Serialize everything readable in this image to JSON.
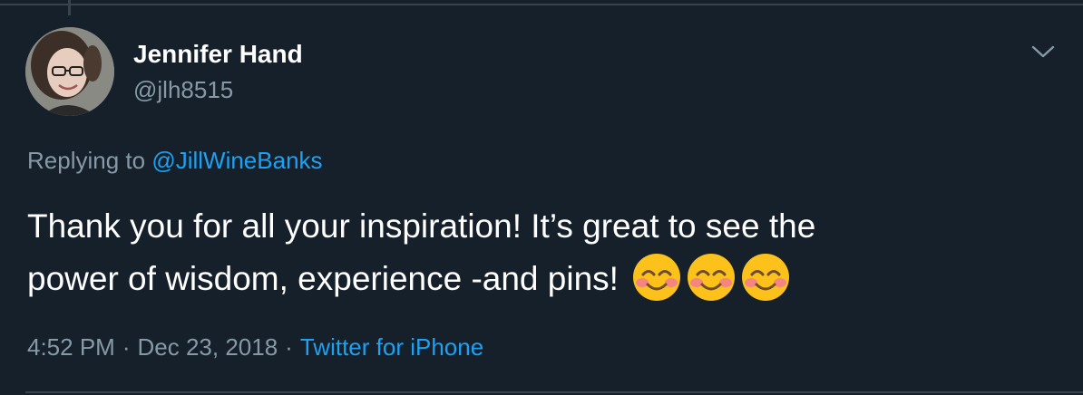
{
  "author": {
    "display_name": "Jennifer Hand",
    "handle": "@jlh8515",
    "avatar_icon": "user-avatar"
  },
  "reply": {
    "prefix": "Replying to ",
    "mention": "@JillWineBanks"
  },
  "tweet": {
    "text_line1": "Thank you for all your inspiration! It’s great to see the",
    "text_line2": "power of wisdom, experience -and pins!",
    "emojis": [
      "smiling-face-with-smiling-eyes",
      "smiling-face-with-smiling-eyes",
      "smiling-face-with-smiling-eyes"
    ]
  },
  "meta": {
    "time": "4:52 PM",
    "separator": "·",
    "date": "Dec 23, 2018",
    "source": "Twitter for iPhone"
  },
  "colors": {
    "background": "#15202b",
    "primary_text": "#ffffff",
    "secondary_text": "#8899a6",
    "accent": "#1da1f2",
    "border": "#38444d"
  },
  "icons": {
    "more": "chevron-down-icon"
  }
}
